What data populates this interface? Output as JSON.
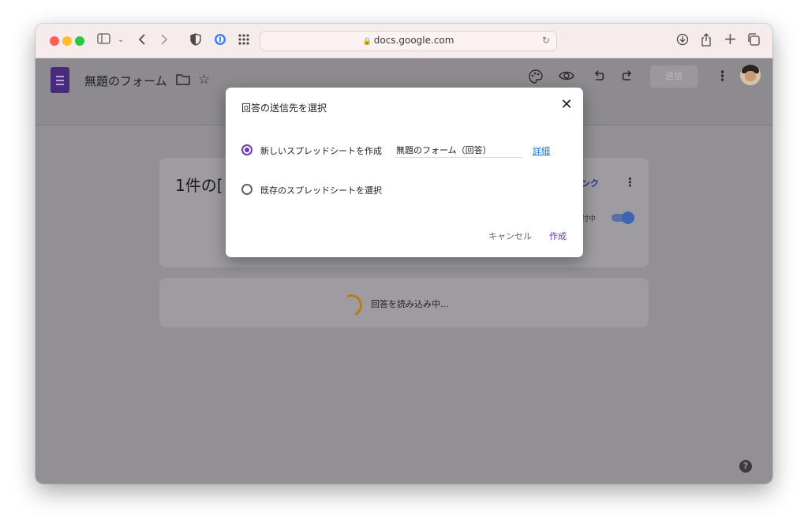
{
  "browser": {
    "url": "docs.google.com",
    "icons": {
      "sidebar": "sidebar-icon",
      "back": "chevron-left-icon",
      "forward": "chevron-right-icon",
      "shield": "shield-icon",
      "password": "password-manager-icon",
      "grid": "grid-icon",
      "reload": "reload-icon",
      "download": "download-icon",
      "share": "share-icon",
      "new_tab": "plus-icon",
      "tabs": "tabs-overview-icon"
    }
  },
  "app": {
    "title": "無題のフォーム",
    "send_label": "送信"
  },
  "card": {
    "title": "1件の[",
    "link_fragment": "ンク",
    "accepting_fragment": "付中"
  },
  "loading": {
    "text": "回答を読み込み中..."
  },
  "dialog": {
    "title": "回答の送信先を選択",
    "option_new_label": "新しいスプレッドシートを作成",
    "sheet_name": "無題のフォーム（回答）",
    "details_link": "詳細",
    "option_existing_label": "既存のスプレッドシートを選択",
    "cancel_label": "キャンセル",
    "create_label": "作成",
    "selected_option": "new"
  },
  "colors": {
    "accent": "#673ab7",
    "link": "#1a73e8",
    "spinner": "#f4a21d"
  }
}
